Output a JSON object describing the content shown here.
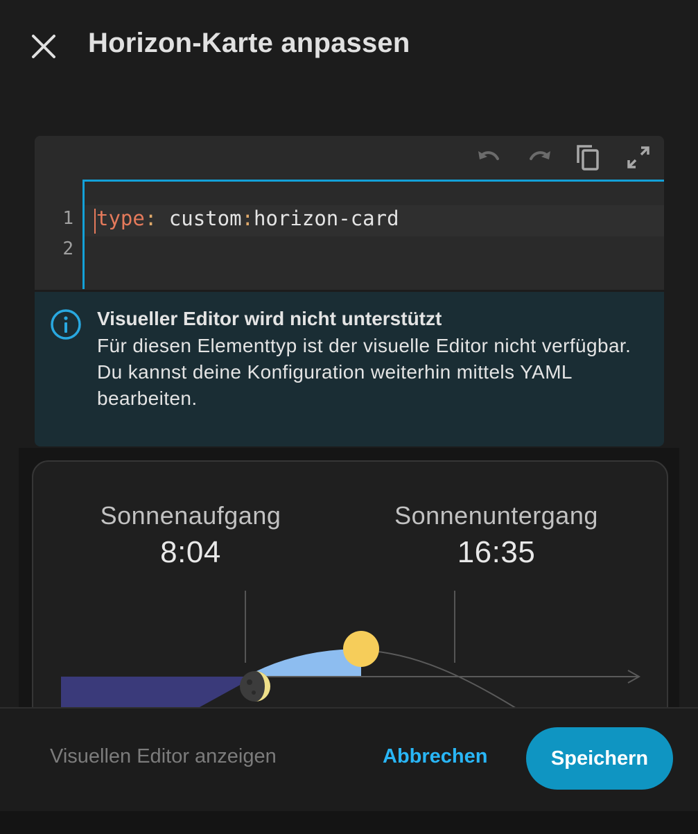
{
  "header": {
    "title": "Horizon-Karte anpassen"
  },
  "editor": {
    "line_numbers": [
      "1",
      "2"
    ],
    "code": {
      "key": "type",
      "colon": ":",
      "value_prefix": "custom",
      "value_colon": ":",
      "value_rest": "horizon-card"
    }
  },
  "alert": {
    "title": "Visueller Editor wird nicht unterstützt",
    "line1": "Für diesen Elementtyp ist der visuelle Editor nicht verfügbar.",
    "line2": "Du kannst deine Konfiguration weiterhin mittels YAML bearbeiten."
  },
  "card": {
    "sunrise_label": "Sonnenaufgang",
    "sunrise_time": "8:04",
    "sunset_label": "Sonnenuntergang",
    "sunset_time": "16:35"
  },
  "footer": {
    "show_visual_label": "Visuellen Editor anzeigen",
    "cancel_label": "Abbrechen",
    "save_label": "Speichern"
  },
  "colors": {
    "accent": "#13a1d8",
    "save_button": "#0f95c2",
    "link": "#29b6f6",
    "sun": "#f6cd5a",
    "day_area": "#8dbdf0",
    "night_area": "#3a3a7a",
    "moon": "#efe08a"
  }
}
